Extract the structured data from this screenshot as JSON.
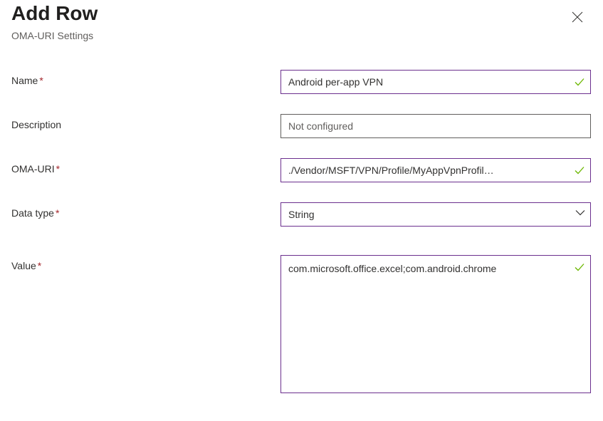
{
  "header": {
    "title": "Add Row",
    "subtitle": "OMA-URI Settings"
  },
  "form": {
    "name": {
      "label": "Name",
      "required": true,
      "value": "Android per-app VPN",
      "validated": true
    },
    "description": {
      "label": "Description",
      "required": false,
      "placeholder": "Not configured",
      "value": ""
    },
    "omauri": {
      "label": "OMA-URI",
      "required": true,
      "value": "./Vendor/MSFT/VPN/Profile/MyAppVpnProfil…",
      "validated": true
    },
    "datatype": {
      "label": "Data type",
      "required": true,
      "value": "String"
    },
    "value": {
      "label": "Value",
      "required": true,
      "value": "com.microsoft.office.excel;com.android.chrome",
      "validated": true
    }
  },
  "colors": {
    "accent": "#6b2f8e",
    "required": "#a4262c",
    "success": "#6bb700"
  }
}
